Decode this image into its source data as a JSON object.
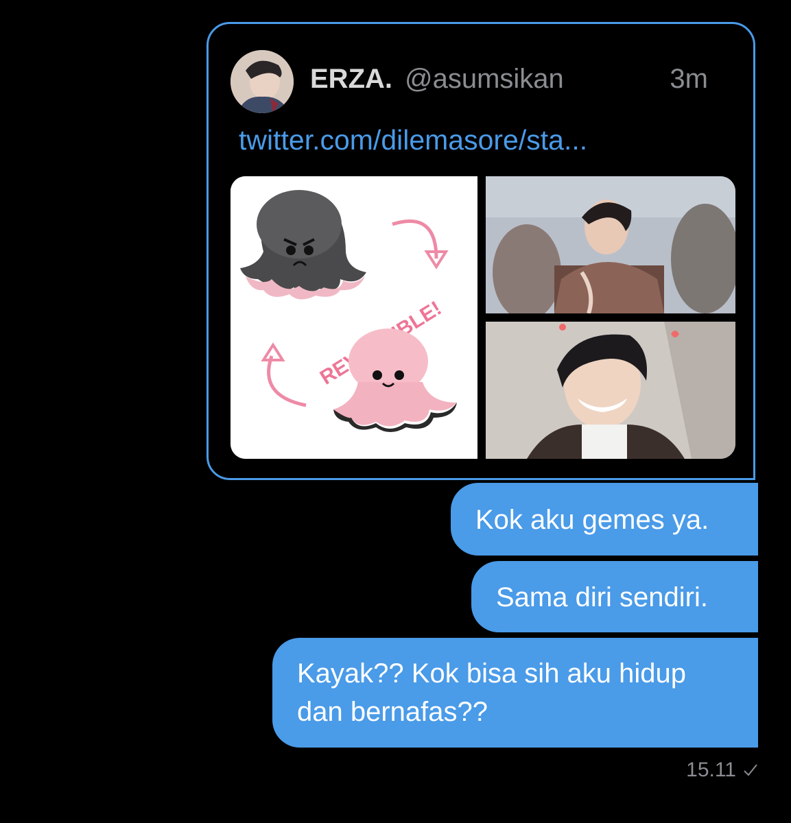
{
  "tweet": {
    "display_name": "ERZA.",
    "handle": "@asumsikan",
    "time_ago": "3m",
    "link": "twitter.com/dilemasore/sta...",
    "media": {
      "left_image_text": "REVERSIBLE!"
    }
  },
  "messages": [
    {
      "text": "Kok aku gemes ya."
    },
    {
      "text": "Sama diri sendiri."
    },
    {
      "text": "Kayak?? Kok bisa sih aku hidup dan bernafas??"
    }
  ],
  "status": {
    "timestamp": "15.11",
    "read_icon": "check-icon"
  },
  "colors": {
    "accent": "#4a9be8",
    "background": "#000000",
    "muted": "#8a8d91"
  }
}
